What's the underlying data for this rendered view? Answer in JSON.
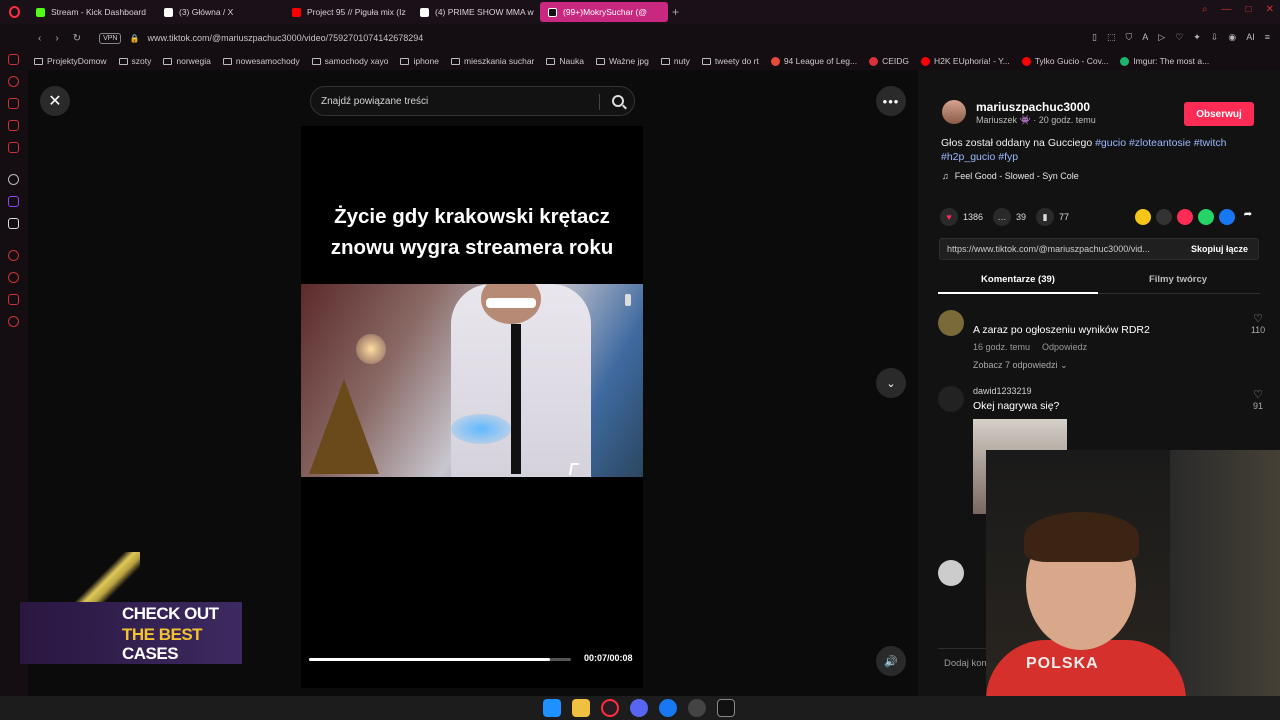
{
  "browser": {
    "tabs": [
      {
        "label": "Stream - Kick Dashboard",
        "color": "#53fc18"
      },
      {
        "label": "(3) Główna / X",
        "color": "#ffffff"
      },
      {
        "label": "Project 95 // Pigułа mix (Iz",
        "color": "#ff0000"
      },
      {
        "label": "(4) PRIME SHOW MMA w",
        "color": "#ffffff"
      },
      {
        "label": "(99+)MokrySuchar (@",
        "color": "#ffffff",
        "active": true
      }
    ],
    "url": "www.tiktok.com/@mariuszpachuc3000/video/7592701074142678294",
    "vpn_label": "VPN",
    "bookmarks": [
      {
        "label": "ProjektyDomow",
        "type": "folder"
      },
      {
        "label": "szoty",
        "type": "folder"
      },
      {
        "label": "norwegia",
        "type": "folder"
      },
      {
        "label": "nowesamochody",
        "type": "folder"
      },
      {
        "label": "samochody xayo",
        "type": "folder"
      },
      {
        "label": "iphone",
        "type": "folder"
      },
      {
        "label": "mieszkania suchar",
        "type": "folder"
      },
      {
        "label": "Nauka",
        "type": "folder"
      },
      {
        "label": "Ważne jpg",
        "type": "folder"
      },
      {
        "label": "nuty",
        "type": "folder"
      },
      {
        "label": "tweety do rt",
        "type": "folder"
      },
      {
        "label": "94 League of Leg...",
        "type": "site",
        "color": "#e84a3c"
      },
      {
        "label": "CEIDG",
        "type": "site",
        "color": "#d9323a"
      },
      {
        "label": "H2K EUphoria! - Y...",
        "type": "site",
        "color": "#ff0000"
      },
      {
        "label": "Tylko Gucio - Cov...",
        "type": "site",
        "color": "#ff0000"
      },
      {
        "label": "Imgur: The most a...",
        "type": "site",
        "color": "#1bb76e"
      }
    ]
  },
  "search": {
    "placeholder": "Znajdź powiązane treści"
  },
  "video": {
    "caption": "Życie gdy krakowski krętacz znowu wygra streamera roku",
    "time": "00:07/00:08",
    "progress": 0.92
  },
  "author": {
    "handle": "mariuszpachuc3000",
    "subline": "Mariuszek 👾 · 20 godz. temu",
    "follow_label": "Obserwuj"
  },
  "description": {
    "text": "Głos został oddany na Gucciego ",
    "tags": [
      "#gucio",
      "#zloteantosie",
      "#twitch",
      "#h2p_gucio",
      "#fyp"
    ],
    "music": "Feel Good - Slowed - Syn Cole"
  },
  "stats": {
    "likes": "1386",
    "comments": "39",
    "saves": "77"
  },
  "link": {
    "url": "https://www.tiktok.com/@mariuszpachuc3000/vid...",
    "copy_label": "Skopiuj łącze"
  },
  "tabs": {
    "comments": "Komentarze (39)",
    "creator_videos": "Filmy twórcy"
  },
  "comments": [
    {
      "user": "",
      "text": "A zaraz po ogłoszeniu wyników RDR2",
      "time": "16 godz. temu",
      "reply": "Odpowiedz",
      "more": "Zobacz 7 odpowiedzi",
      "likes": "110"
    },
    {
      "user": "dawid1233219",
      "text": "Okej nagrywa się?",
      "likes": "91"
    }
  ],
  "comment_input_placeholder": "Dodaj kom",
  "ad": {
    "line1": "CHECK OUT",
    "line2": "THE BEST",
    "line3": "CASES"
  },
  "webcam": {
    "shirt_text": "POLSKA"
  }
}
